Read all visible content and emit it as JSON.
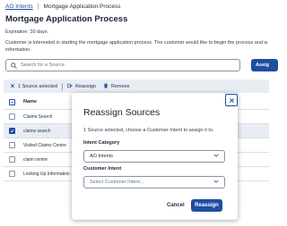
{
  "breadcrumb": {
    "parent": "AO Intents",
    "separator": "|",
    "current": "Mortgage Application Process"
  },
  "page": {
    "title": "Mortgage Application Process",
    "expiration": "Expiration: 30 days",
    "description": "Customer is interested in starting the mortgage application process. The customer would like to begin the process and will provide any requ",
    "description_line2": "information."
  },
  "search": {
    "placeholder": "Search for a Source",
    "assign_label": "Assig"
  },
  "action_bar": {
    "selected_label": "1 Source selected",
    "reassign_label": "Reassign",
    "remove_label": "Remove"
  },
  "table": {
    "header": "Name",
    "rows": [
      {
        "name": "Claims Search",
        "checked": false
      },
      {
        "name": "claims search",
        "checked": true
      },
      {
        "name": "Visited Claims Centre",
        "checked": false
      },
      {
        "name": "claim centre",
        "checked": false
      },
      {
        "name": "Looking Up Information",
        "checked": false
      }
    ]
  },
  "modal": {
    "title": "Reassign Sources",
    "subtitle": "1 Source selected, choose a Customer Intent to assign it to.",
    "intent_category_label": "Intent Category",
    "intent_category_value": "AO Intents",
    "customer_intent_label": "Customer Intent",
    "customer_intent_placeholder": "Select Customer Intent...",
    "cancel_label": "Cancel",
    "reassign_label": "Reassign"
  },
  "colors": {
    "primary": "#1f4ea1",
    "selection_bg": "#e8edf4"
  }
}
